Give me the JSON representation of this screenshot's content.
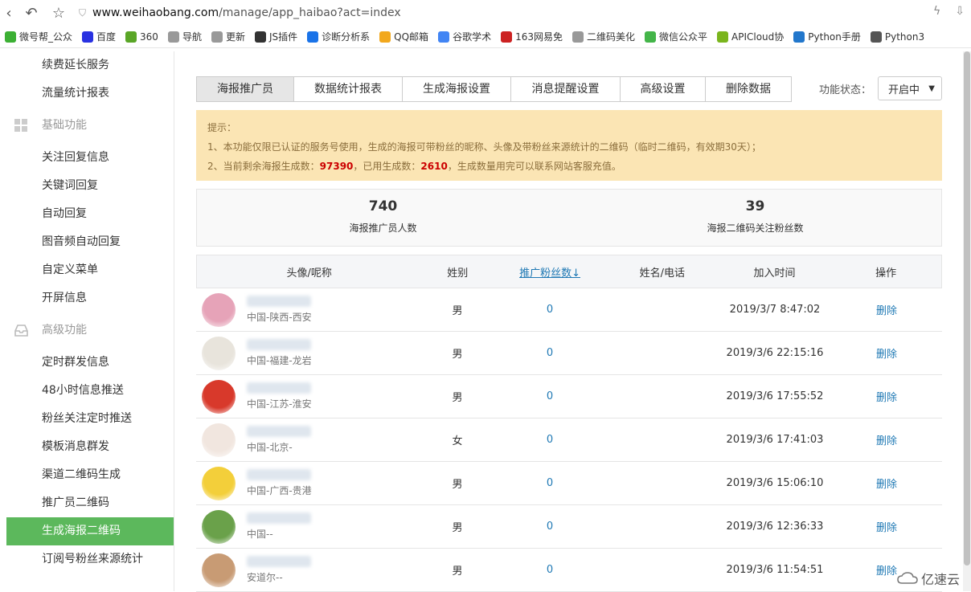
{
  "browser": {
    "url_host": "www.weihaobang.com",
    "url_path": "/manage/app_haibao?act=index",
    "bookmarks": [
      {
        "label": "微号帮_公众",
        "color": "#3cb034"
      },
      {
        "label": "百度",
        "color": "#2932e1"
      },
      {
        "label": "360",
        "color": "#5aa627"
      },
      {
        "label": "导航",
        "color": "#999999"
      },
      {
        "label": "更新",
        "color": "#999999"
      },
      {
        "label": "JS插件",
        "color": "#333333"
      },
      {
        "label": "诊断分析系",
        "color": "#1a73e8"
      },
      {
        "label": "QQ邮箱",
        "color": "#f2a81d"
      },
      {
        "label": "谷歌学术",
        "color": "#4285f4"
      },
      {
        "label": "163网易免",
        "color": "#cc2222"
      },
      {
        "label": "二维码美化",
        "color": "#999999"
      },
      {
        "label": "微信公众平",
        "color": "#44b549"
      },
      {
        "label": "APICloud协",
        "color": "#7ab51d"
      },
      {
        "label": "Python手册",
        "color": "#2277cc"
      },
      {
        "label": "Python3",
        "color": "#555555"
      }
    ]
  },
  "sidebar": {
    "top_items": [
      "续费延长服务",
      "流量统计报表"
    ],
    "groups": [
      {
        "title": "基础功能",
        "icon": "grid-icon",
        "items": [
          "关注回复信息",
          "关键词回复",
          "自动回复",
          "图音频自动回复",
          "自定义菜单",
          "开屏信息"
        ]
      },
      {
        "title": "高级功能",
        "icon": "inbox-icon",
        "items": [
          "定时群发信息",
          "48小时信息推送",
          "粉丝关注定时推送",
          "模板消息群发",
          "渠道二维码生成",
          "推广员二维码",
          "生成海报二维码",
          "订阅号粉丝来源统计"
        ]
      }
    ],
    "active": "生成海报二维码"
  },
  "tabs": [
    "海报推广员",
    "数据统计报表",
    "生成海报设置",
    "消息提醒设置",
    "高级设置",
    "删除数据"
  ],
  "status": {
    "label": "功能状态：",
    "value": "开启中"
  },
  "tip": {
    "title": "提示：",
    "line1": "1、本功能仅限已认证的服务号使用，生成的海报可带粉丝的昵称、头像及带粉丝来源统计的二维码（临时二维码，有效期30天）；",
    "line2_a": "2、当前剩余海报生成数：",
    "remaining": "97390",
    "line2_b": "，已用生成数：",
    "used": "2610",
    "line2_c": "，生成数量用完可以联系网站客服充值。"
  },
  "stats": [
    {
      "value": "740",
      "label": "海报推广员人数"
    },
    {
      "value": "39",
      "label": "海报二维码关注粉丝数"
    }
  ],
  "table": {
    "headers": [
      "头像/呢称",
      "姓别",
      "推广粉丝数↓",
      "姓名/电话",
      "加入时间",
      "操作"
    ],
    "rows": [
      {
        "location": "中国-陕西-西安",
        "gender": "男",
        "fans": "0",
        "name": "",
        "time": "2019/3/7 8:47:02",
        "action": "删除",
        "avatar": "#e6a3b8"
      },
      {
        "location": "中国-福建-龙岩",
        "gender": "男",
        "fans": "0",
        "name": "",
        "time": "2019/3/6 22:15:16",
        "action": "删除",
        "avatar": "#e8e4dc"
      },
      {
        "location": "中国-江苏-淮安",
        "gender": "男",
        "fans": "0",
        "name": "",
        "time": "2019/3/6 17:55:52",
        "action": "删除",
        "avatar": "#d8392b"
      },
      {
        "location": "中国-北京-",
        "gender": "女",
        "fans": "0",
        "name": "",
        "time": "2019/3/6 17:41:03",
        "action": "删除",
        "avatar": "#f1e6df"
      },
      {
        "location": "中国-广西-贵港",
        "gender": "男",
        "fans": "0",
        "name": "",
        "time": "2019/3/6 15:06:10",
        "action": "删除",
        "avatar": "#f3cf3a"
      },
      {
        "location": "中国--",
        "gender": "男",
        "fans": "0",
        "name": "",
        "time": "2019/3/6 12:36:33",
        "action": "删除",
        "avatar": "#6aa14a"
      },
      {
        "location": "安道尔--",
        "gender": "男",
        "fans": "0",
        "name": "",
        "time": "2019/3/6 11:54:51",
        "action": "删除",
        "avatar": "#c89b74"
      }
    ]
  },
  "watermark": "亿速云"
}
